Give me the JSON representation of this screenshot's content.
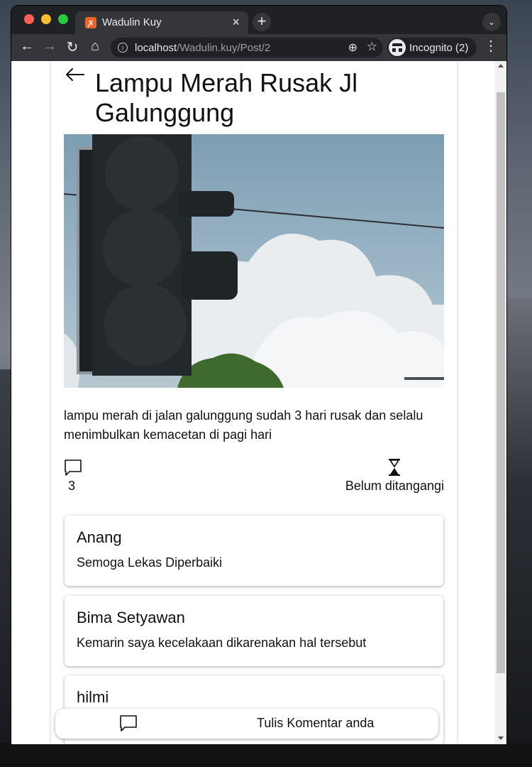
{
  "browser": {
    "tab_title": "Wadulin Kuy",
    "favicon": "xampp-icon",
    "tab_close": "×",
    "new_tab": "+",
    "url_host": "localhost",
    "url_path": "/Wadulin.kuy/Post/2",
    "incognito_label": "Incognito (2)"
  },
  "post": {
    "title": "Lampu Merah Rusak Jl Galunggung",
    "image": "traffic-light-photo",
    "description": "lampu merah di jalan galunggung sudah 3 hari rusak dan selalu menimbulkan kemacetan di pagi hari",
    "comment_count": "3",
    "status": "Belum ditangangi"
  },
  "comments": [
    {
      "name": "Anang",
      "text": "Semoga Lekas Diperbaiki"
    },
    {
      "name": "Bima Setyawan",
      "text": "Kemarin saya kecelakaan dikarenakan hal tersebut"
    },
    {
      "name": "hilmi",
      "text": ""
    }
  ],
  "compose": {
    "label": "Tulis Komentar anda"
  },
  "colors": {
    "browser_frame": "#202124",
    "toolbar": "#35363a",
    "page_bg": "#ffffff",
    "text": "#111111"
  }
}
